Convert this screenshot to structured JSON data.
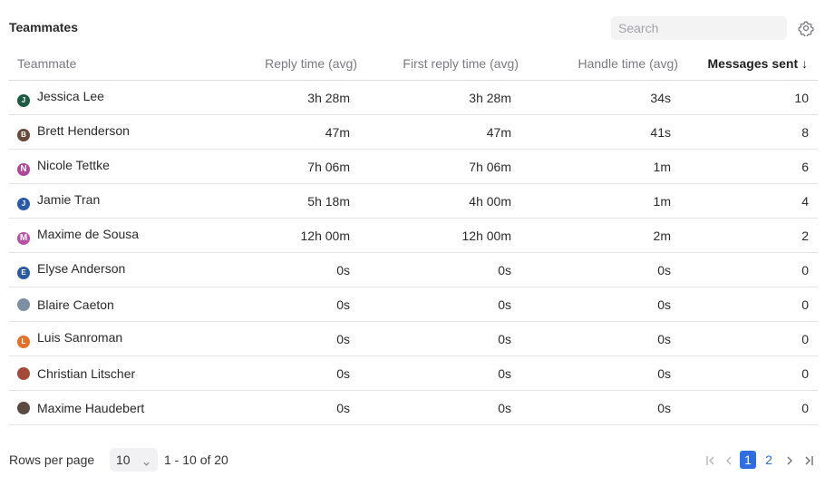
{
  "header": {
    "title": "Teammates",
    "search_placeholder": "Search",
    "settings_icon": "gear-icon"
  },
  "table": {
    "columns": [
      "Teammate",
      "Reply time (avg)",
      "First reply time (avg)",
      "Handle time (avg)",
      "Messages sent ↓"
    ],
    "rows": [
      {
        "name": "Jessica Lee",
        "avatar_letter": "J",
        "avatar_color": "#1f5a44",
        "reply": "3h 28m",
        "first_reply": "3h 28m",
        "handle": "34s",
        "messages": "10"
      },
      {
        "name": "Brett Henderson",
        "avatar_letter": "B",
        "avatar_color": "#6b4a3e",
        "reply": "47m",
        "first_reply": "47m",
        "handle": "41s",
        "messages": "8"
      },
      {
        "name": "Nicole Tettke",
        "avatar_letter": "N",
        "avatar_color": "#b0489a",
        "reply": "7h 06m",
        "first_reply": "7h 06m",
        "handle": "1m",
        "messages": "6"
      },
      {
        "name": "Jamie Tran",
        "avatar_letter": "J",
        "avatar_color": "#2c5aa6",
        "reply": "5h 18m",
        "first_reply": "4h 00m",
        "handle": "1m",
        "messages": "4"
      },
      {
        "name": "Maxime de Sousa",
        "avatar_letter": "M",
        "avatar_color": "#b552a3",
        "reply": "12h 00m",
        "first_reply": "12h 00m",
        "handle": "2m",
        "messages": "2"
      },
      {
        "name": "Elyse Anderson",
        "avatar_letter": "E",
        "avatar_color": "#2a5aa0",
        "reply": "0s",
        "first_reply": "0s",
        "handle": "0s",
        "messages": "0"
      },
      {
        "name": "Blaire Caeton",
        "avatar_letter": "",
        "avatar_color": "#7f8fa3",
        "reply": "0s",
        "first_reply": "0s",
        "handle": "0s",
        "messages": "0"
      },
      {
        "name": "Luis Sanroman",
        "avatar_letter": "L",
        "avatar_color": "#e2722b",
        "reply": "0s",
        "first_reply": "0s",
        "handle": "0s",
        "messages": "0"
      },
      {
        "name": "Christian Litscher",
        "avatar_letter": "",
        "avatar_color": "#a34a3a",
        "reply": "0s",
        "first_reply": "0s",
        "handle": "0s",
        "messages": "0"
      },
      {
        "name": "Maxime Haudebert",
        "avatar_letter": "",
        "avatar_color": "#5b4a42",
        "reply": "0s",
        "first_reply": "0s",
        "handle": "0s",
        "messages": "0"
      }
    ]
  },
  "footer": {
    "rows_per_page_label": "Rows per page",
    "rows_per_page_value": "10",
    "range_text": "1 - 10 of 20",
    "pages": [
      "1",
      "2"
    ],
    "current_page": "1"
  },
  "colors": {
    "accent": "#2f6de0",
    "border": "#d9d9dc",
    "header_text": "#7a7a80"
  }
}
